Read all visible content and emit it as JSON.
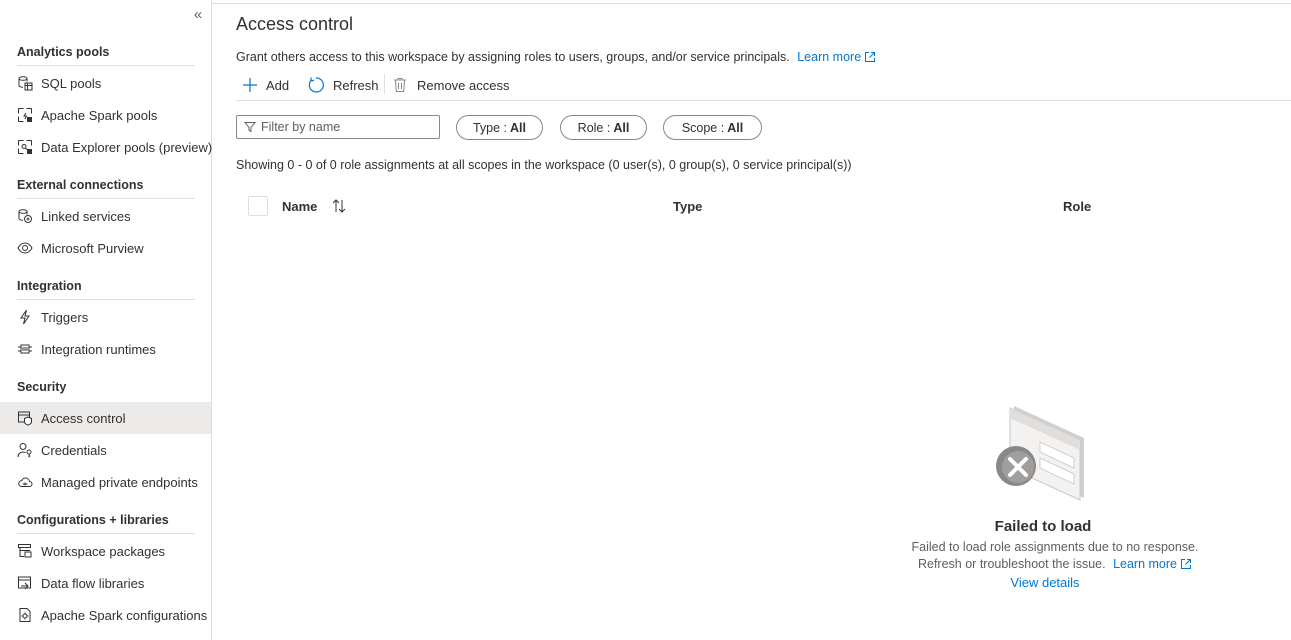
{
  "sidebar": {
    "collapse_glyph": "«",
    "sections": [
      {
        "title": "Analytics pools",
        "items": [
          {
            "label": "SQL pools",
            "icon": "sql-pool-icon"
          },
          {
            "label": "Apache Spark pools",
            "icon": "spark-pool-icon"
          },
          {
            "label": "Data Explorer pools (preview)",
            "icon": "data-explorer-pool-icon"
          }
        ]
      },
      {
        "title": "External connections",
        "items": [
          {
            "label": "Linked services",
            "icon": "linked-services-icon"
          },
          {
            "label": "Microsoft Purview",
            "icon": "purview-eye-icon"
          }
        ]
      },
      {
        "title": "Integration",
        "items": [
          {
            "label": "Triggers",
            "icon": "lightning-icon"
          },
          {
            "label": "Integration runtimes",
            "icon": "integration-runtime-icon"
          }
        ]
      },
      {
        "title": "Security",
        "items": [
          {
            "label": "Access control",
            "icon": "access-control-icon",
            "active": true
          },
          {
            "label": "Credentials",
            "icon": "credentials-icon"
          },
          {
            "label": "Managed private endpoints",
            "icon": "cloud-endpoint-icon"
          }
        ]
      },
      {
        "title": "Configurations + libraries",
        "items": [
          {
            "label": "Workspace packages",
            "icon": "workspace-packages-icon"
          },
          {
            "label": "Data flow libraries",
            "icon": "data-flow-library-icon"
          },
          {
            "label": "Apache Spark configurations",
            "icon": "spark-config-icon"
          }
        ]
      }
    ]
  },
  "main": {
    "title": "Access control",
    "description": "Grant others access to this workspace by assigning roles to users, groups, and/or service principals.",
    "learn_more": "Learn more",
    "toolbar": {
      "add": "Add",
      "refresh": "Refresh",
      "remove": "Remove access"
    },
    "filter": {
      "placeholder": "Filter by name"
    },
    "pills": {
      "type_label": "Type :",
      "type_value": "All",
      "role_label": "Role :",
      "role_value": "All",
      "scope_label": "Scope :",
      "scope_value": "All"
    },
    "showing": "Showing 0 - 0 of 0 role assignments at all scopes in the workspace (0 user(s), 0 group(s), 0 service principal(s))",
    "columns": {
      "name": "Name",
      "type": "Type",
      "role": "Role"
    },
    "empty": {
      "title": "Failed to load",
      "line1": "Failed to load role assignments due to no response.",
      "line2": "Refresh or troubleshoot the issue.",
      "learn_more": "Learn more",
      "view_details": "View details"
    }
  },
  "colors": {
    "link": "#0078d4",
    "active_nav_bg": "#edebe9",
    "border": "#e1dfdd"
  }
}
